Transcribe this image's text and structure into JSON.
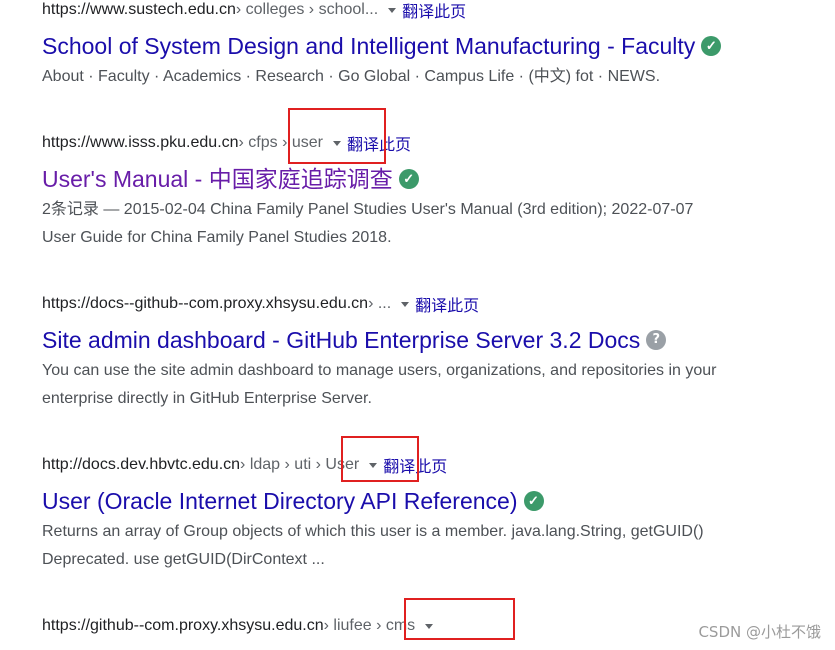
{
  "results": [
    {
      "url_host": "https://www.sustech.edu.cn",
      "url_path": " › colleges › school...",
      "translate": "翻译此页",
      "title": "School of System Design and Intelligent Manufacturing - Faculty",
      "title_badge": "verified",
      "snippet_links": [
        "About",
        "Faculty",
        "Academics",
        "Research",
        "Go Global",
        "Campus Life",
        "(中文) fot",
        "NEWS."
      ],
      "separator": " · "
    },
    {
      "url_host": "https://www.isss.pku.edu.cn",
      "url_path": " › cfps › user",
      "translate": "翻译此页",
      "title": "User's Manual - 中国家庭追踪调查",
      "title_badge": "verified",
      "snippet_line1": "2条记录 — 2015-02-04 China Family Panel Studies User's Manual (3rd edition); 2022-07-07",
      "snippet_line2": "User Guide for China Family Panel Studies 2018."
    },
    {
      "url_host": "https://docs--github--com.proxy.xhsysu.edu.cn",
      "url_path": " › ...",
      "translate": "翻译此页",
      "title": "Site admin dashboard - GitHub Enterprise Server 3.2 Docs",
      "title_badge": "unknown",
      "snippet_line1": "You can use the site admin dashboard to manage users, organizations, and repositories in your",
      "snippet_line2": "enterprise directly in GitHub Enterprise Server."
    },
    {
      "url_host": "http://docs.dev.hbvtc.edu.cn",
      "url_path": " › ldap › uti › User",
      "translate": "翻译此页",
      "title": "User (Oracle Internet Directory API Reference)",
      "title_badge": "verified",
      "snippet_line1": "Returns an array of Group objects of which this user is a member. java.lang.String, getGUID()",
      "snippet_line2": "Deprecated. use getGUID(DirContext ..."
    },
    {
      "url_host": "https://github--com.proxy.xhsysu.edu.cn",
      "url_path": " › liufee › cms"
    }
  ],
  "badge_glyphs": {
    "verified": "✓",
    "unknown": "?"
  },
  "watermark": "CSDN @小杜不饿",
  "colors": {
    "link": "#1a0dab",
    "visited": "#681da8",
    "highlight_box": "#e02020",
    "verified_badge": "#3c9a6a"
  }
}
